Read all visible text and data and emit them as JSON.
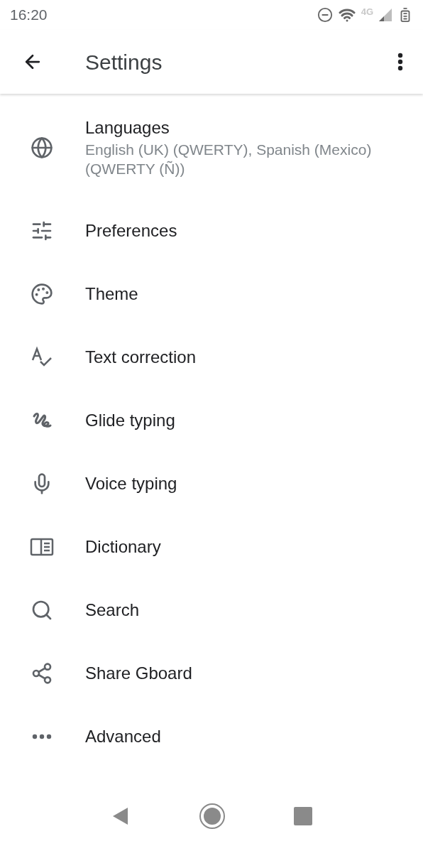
{
  "status_bar": {
    "time": "16:20",
    "network": "4G"
  },
  "app_bar": {
    "title": "Settings"
  },
  "items": [
    {
      "kind": "languages",
      "title": "Languages",
      "subtitle": "English (UK) (QWERTY), Spanish (Mexico) (QWERTY (Ñ))"
    },
    {
      "kind": "preferences",
      "title": "Preferences"
    },
    {
      "kind": "theme",
      "title": "Theme"
    },
    {
      "kind": "text_correction",
      "title": "Text correction"
    },
    {
      "kind": "glide",
      "title": "Glide typing"
    },
    {
      "kind": "voice",
      "title": "Voice typing"
    },
    {
      "kind": "dictionary",
      "title": "Dictionary"
    },
    {
      "kind": "search",
      "title": "Search"
    },
    {
      "kind": "share",
      "title": "Share Gboard"
    },
    {
      "kind": "advanced",
      "title": "Advanced"
    }
  ]
}
